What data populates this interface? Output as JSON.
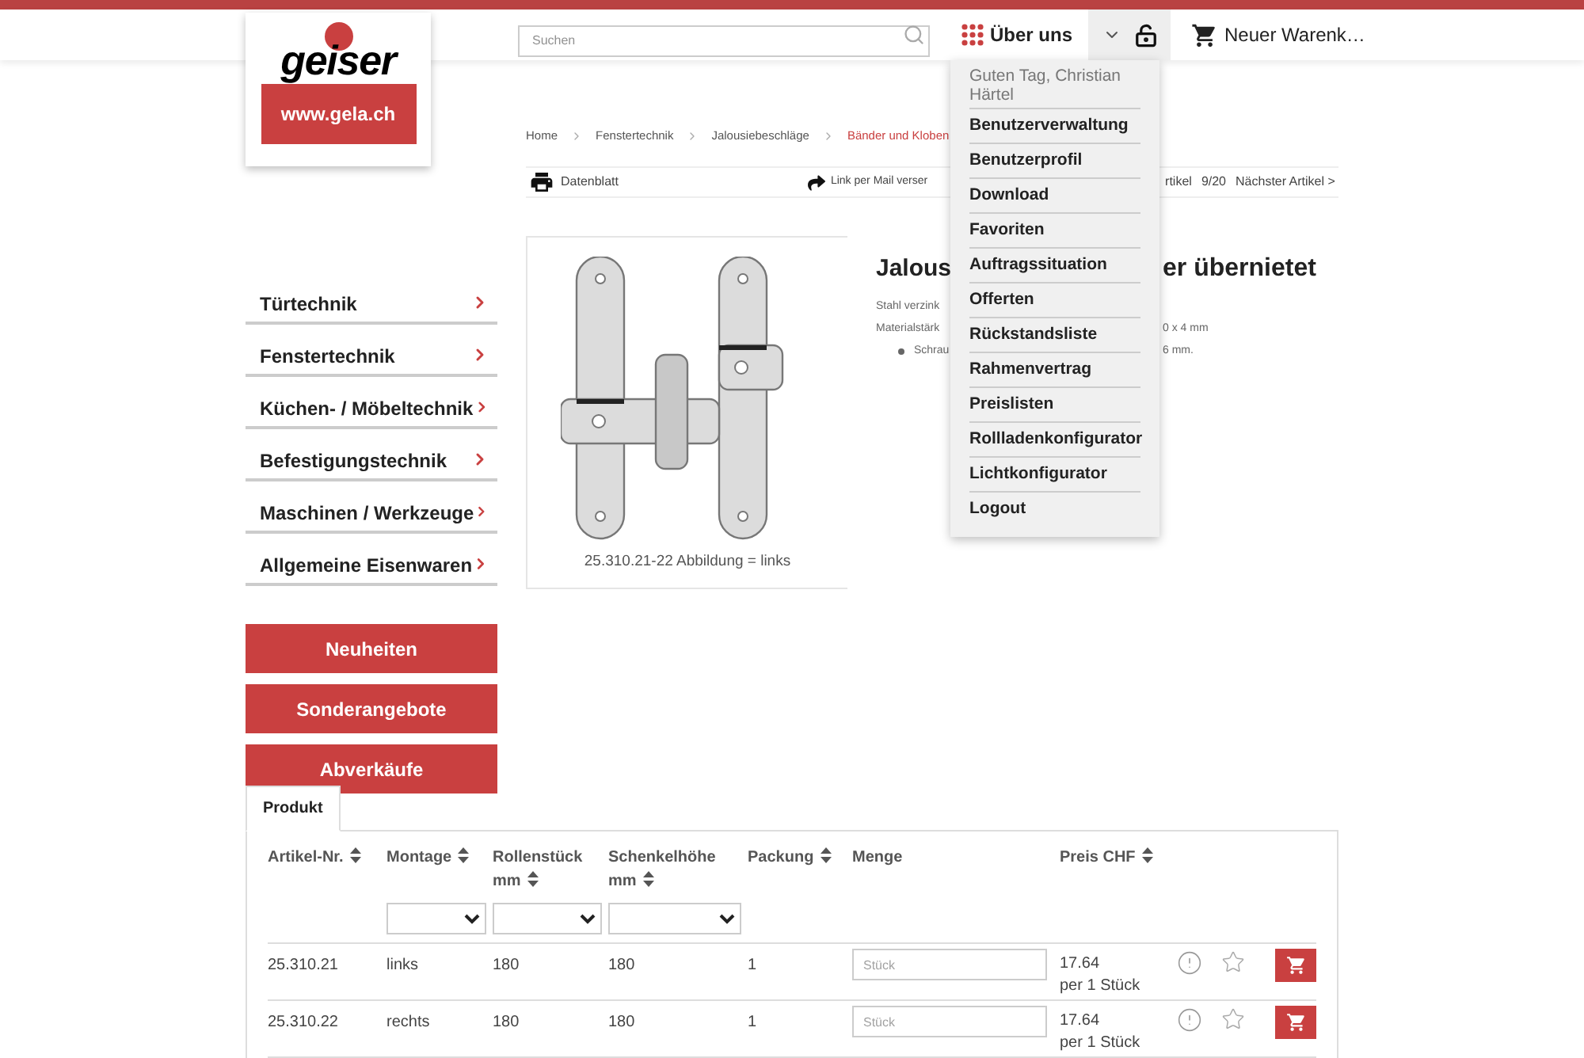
{
  "header": {
    "search": {
      "placeholder": "Suchen"
    },
    "about": "Über uns",
    "cart": "Neuer Warenk…"
  },
  "logo": {
    "wordmark": "geiser",
    "url": "www.gela.ch"
  },
  "user_menu": {
    "expanded": true,
    "greeting": "Guten Tag, Christian Härtel",
    "items": [
      "Benutzerverwaltung",
      "Benutzerprofil",
      "Download",
      "Favoriten",
      "Auftragssituation",
      "Offerten",
      "Rückstandsliste",
      "Rahmenvertrag",
      "Preislisten",
      "Rollladenkonfigurator",
      "Lichtkonfigurator",
      "Logout"
    ]
  },
  "breadcrumb": [
    {
      "label": "Home",
      "current": false
    },
    {
      "label": "Fenstertechnik",
      "current": false
    },
    {
      "label": "Jalousiebeschläge",
      "current": false
    },
    {
      "label": "Bänder und Kloben",
      "current": true
    }
  ],
  "actions": {
    "datasheet": "Datenblatt",
    "mail": "Link per Mail verser",
    "prev": "rtikel",
    "position": "9/20",
    "next": "Nächster Artikel >"
  },
  "product": {
    "image_caption": "25.310.21-22 Abbildung = links",
    "title_parts": [
      "Jalous",
      "er übernietet"
    ],
    "lines": [
      {
        "kind": "text",
        "parts": [
          "Stahl verzink"
        ]
      },
      {
        "kind": "text",
        "parts": [
          "Materialstärk",
          "0 x 4 mm"
        ]
      },
      {
        "kind": "bullet",
        "parts": [
          "Schrau",
          "6 mm."
        ]
      }
    ]
  },
  "categories": [
    "Türtechnik",
    "Fenstertechnik",
    "Küchen- / Möbeltechnik",
    "Befestigungstechnik",
    "Maschinen / Werkzeuge",
    "Allgemeine Eisenwaren"
  ],
  "promo_buttons": [
    "Neuheiten",
    "Sonderangebote",
    "Abverkäufe"
  ],
  "tabs": [
    {
      "label": "Produkt",
      "selected": true
    }
  ],
  "table": {
    "columns": [
      {
        "label": "Artikel-Nr.",
        "sortable": true,
        "filter": false
      },
      {
        "label": "Montage",
        "sortable": true,
        "filter": true
      },
      {
        "label": "Rollenstück mm",
        "sortable": true,
        "filter": true
      },
      {
        "label": "Schenkelhöhe mm",
        "sortable": true,
        "filter": true
      },
      {
        "label": "Packung",
        "sortable": true,
        "filter": false
      },
      {
        "label": "Menge",
        "sortable": false,
        "filter": false
      },
      {
        "label": "Preis CHF",
        "sortable": true,
        "filter": false
      }
    ],
    "rows": [
      {
        "cells": [
          "25.310.21",
          "links",
          "180",
          "180",
          "1"
        ],
        "quantity_placeholder": "Stück",
        "price": "17.64",
        "unit": "per 1 Stück"
      },
      {
        "cells": [
          "25.310.22",
          "rechts",
          "180",
          "180",
          "1"
        ],
        "quantity_placeholder": "Stück",
        "price": "17.64",
        "unit": "per 1 Stück"
      }
    ]
  }
}
